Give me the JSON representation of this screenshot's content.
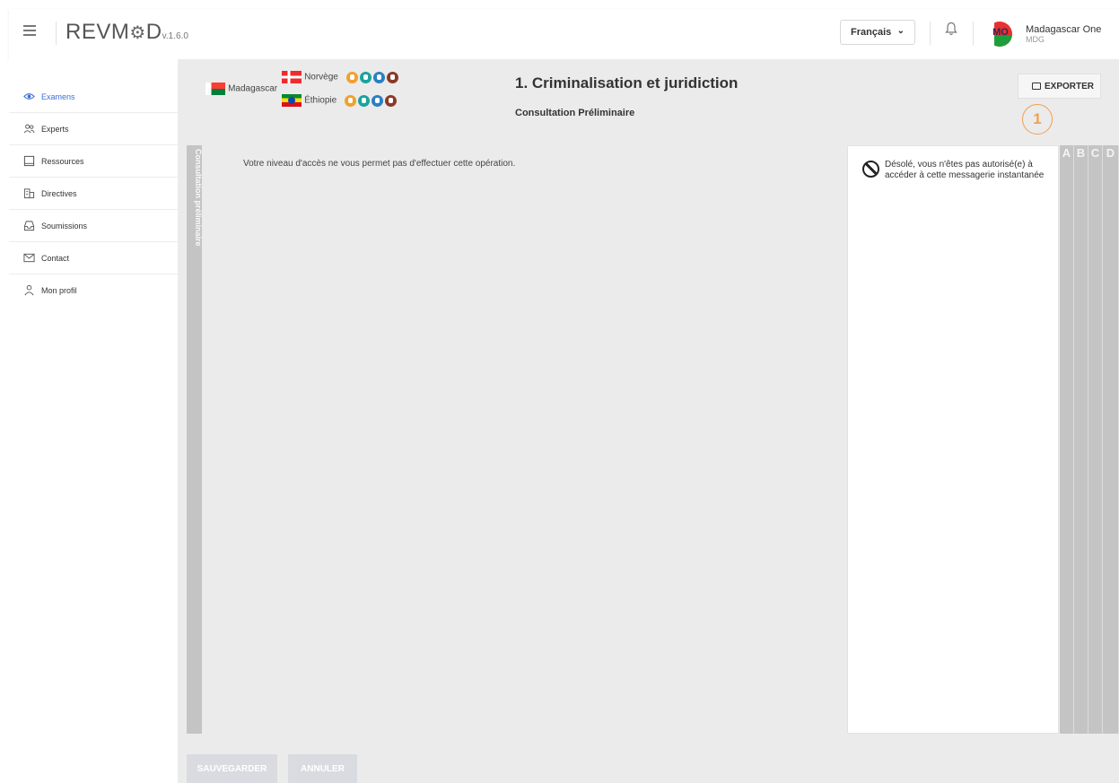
{
  "header": {
    "logo": "REVM⚙D",
    "version": "v.1.6.0",
    "language": "Français",
    "user": {
      "initials": "MO",
      "name": "Madagascar One",
      "code": "MDG"
    }
  },
  "sidebar": {
    "items": [
      {
        "label": "Examens",
        "icon": "eye-icon",
        "active": true
      },
      {
        "label": "Experts",
        "icon": "users-icon"
      },
      {
        "label": "Ressources",
        "icon": "book-icon"
      },
      {
        "label": "Directives",
        "icon": "buildings-icon"
      },
      {
        "label": "Soumissions",
        "icon": "inbox-icon"
      },
      {
        "label": "Contact",
        "icon": "envelope-icon"
      },
      {
        "label": "Mon profil",
        "icon": "user-icon"
      }
    ]
  },
  "main": {
    "country": "Madagascar",
    "reviewers": [
      {
        "name": "Norvège"
      },
      {
        "name": "Éthiopie"
      }
    ],
    "title": "1. Criminalisation et juridiction",
    "subtitle": "Consultation Préliminaire",
    "export_label": "EXPORTER",
    "callout_number": "1",
    "vertical_tab": "Consultation préliminaire",
    "access_message": "Votre niveau d'accès ne vous permet pas d'effectuer cette opération.",
    "chat_message": "Désolé, vous n'êtes pas autorisé(e) à accéder à cette messagerie instantanée",
    "columns": [
      "A",
      "B",
      "C",
      "D"
    ],
    "save_label": "SAUVEGARDER",
    "cancel_label": "ANNULER"
  },
  "colors": {
    "active_nav": "#3b6fd8",
    "callout": "#f0a050",
    "main_bg": "#ebebeb",
    "disabled_button": "#d9dbe1"
  }
}
